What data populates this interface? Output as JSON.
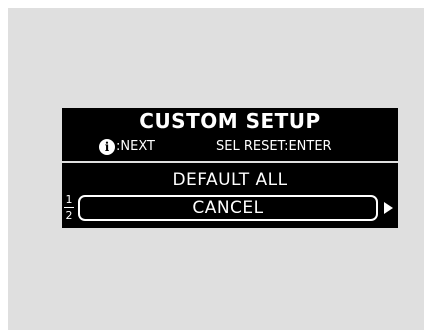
{
  "screen": {
    "title": "CUSTOM SETUP",
    "hints": {
      "info_icon": "info-icon",
      "next_label": ":NEXT",
      "reset_label": "SEL RESET:ENTER"
    },
    "menu": {
      "items": [
        {
          "label": "DEFAULT ALL",
          "selected": false
        },
        {
          "label": "CANCEL",
          "selected": true
        }
      ]
    },
    "page": {
      "current": "1",
      "total": "2"
    },
    "next_page_icon": "triangle-right-icon"
  },
  "colors": {
    "panel_background": "#dfdfdf",
    "screen_background": "#000000",
    "text": "#ffffff"
  }
}
